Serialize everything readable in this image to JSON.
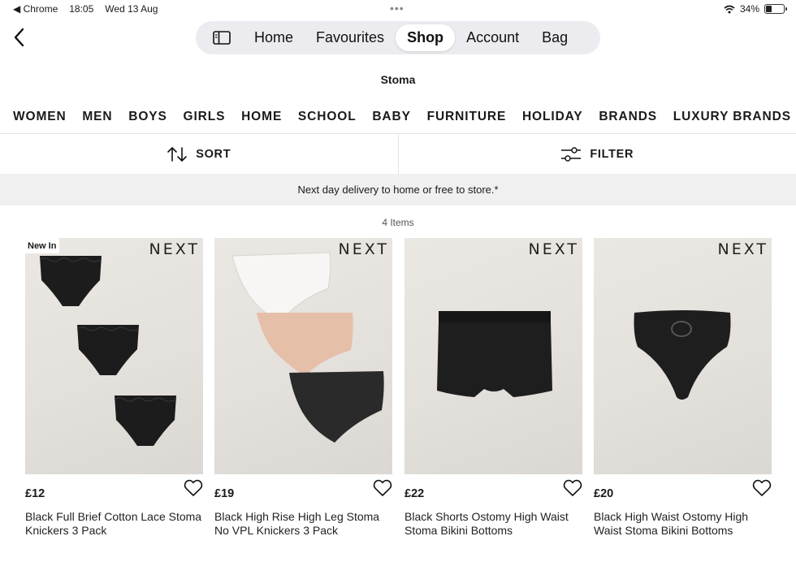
{
  "status_bar": {
    "back_app": "◀ Chrome",
    "time": "18:05",
    "date": "Wed 13 Aug",
    "battery": "34%",
    "battery_level": 0.34
  },
  "nav": {
    "tabs": [
      {
        "label": "Home",
        "active": false
      },
      {
        "label": "Favourites",
        "active": false
      },
      {
        "label": "Shop",
        "active": true
      },
      {
        "label": "Account",
        "active": false
      },
      {
        "label": "Bag",
        "active": false
      }
    ]
  },
  "page_title": "Stoma",
  "categories": [
    "WOMEN",
    "MEN",
    "BOYS",
    "GIRLS",
    "HOME",
    "SCHOOL",
    "BABY",
    "FURNITURE",
    "HOLIDAY",
    "BRANDS",
    "LUXURY BRANDS"
  ],
  "toolbar": {
    "sort_label": "SORT",
    "filter_label": "FILTER"
  },
  "delivery_banner": "Next day delivery to home or free to store.*",
  "item_count": "4 Items",
  "products": [
    {
      "brand": "NEXT",
      "badge": "New In",
      "price": "£12",
      "name": "Black Full Brief Cotton Lace Stoma Knickers 3 Pack"
    },
    {
      "brand": "NEXT",
      "badge": "",
      "price": "£19",
      "name": "Black High Rise High Leg Stoma No VPL Knickers 3 Pack"
    },
    {
      "brand": "NEXT",
      "badge": "",
      "price": "£22",
      "name": "Black Shorts Ostomy High Waist Stoma Bikini Bottoms"
    },
    {
      "brand": "NEXT",
      "badge": "",
      "price": "£20",
      "name": "Black High Waist Ostomy High Waist Stoma Bikini Bottoms"
    }
  ],
  "colors": {
    "garment_black": "#1c1c1c",
    "garment_white": "#f7f6f4",
    "garment_nude": "#e6bfa9",
    "photo_bg": "#e6e2de"
  },
  "icons": {
    "back": "chevron-left-icon",
    "sidebar": "sidebar-icon",
    "sort": "sort-arrows-icon",
    "filter": "sliders-icon",
    "favourite": "heart-icon",
    "wifi": "wifi-icon",
    "battery": "battery-icon"
  }
}
